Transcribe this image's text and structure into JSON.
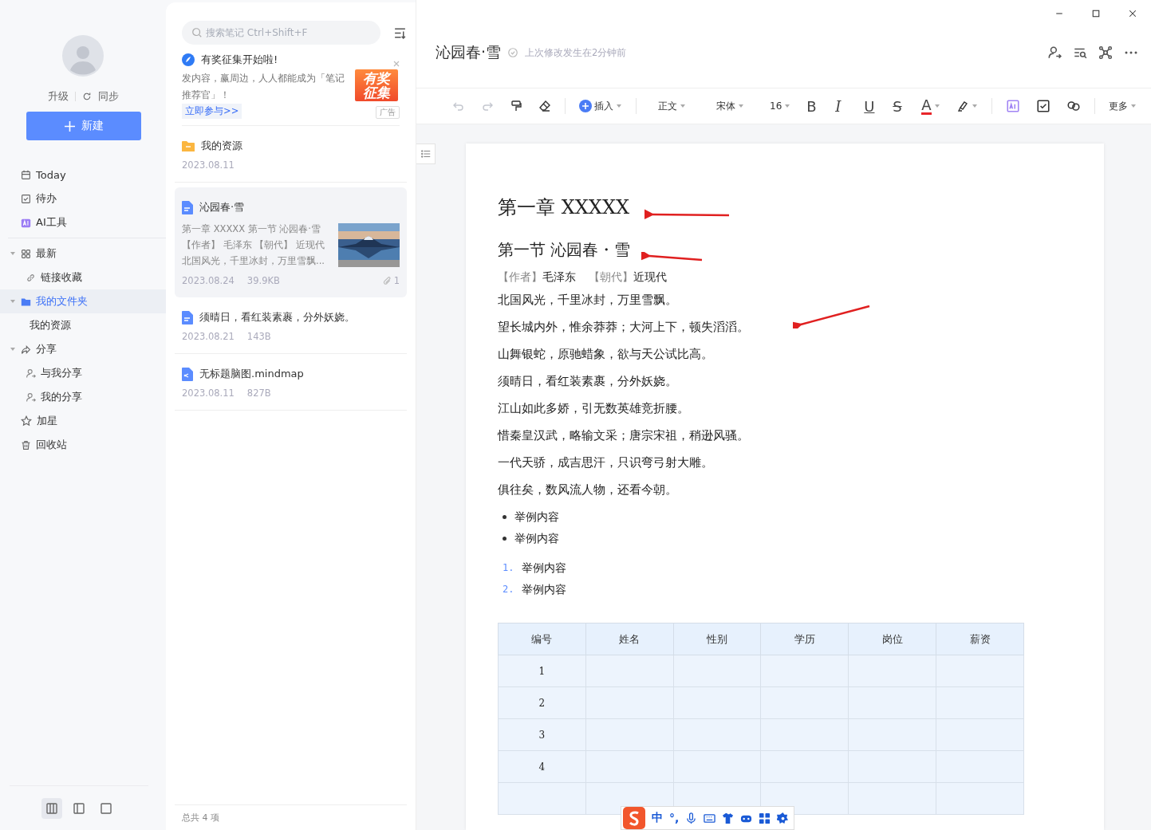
{
  "sidebar": {
    "upgrade": "升级",
    "sync": "同步",
    "new_button": "新建",
    "nav": [
      {
        "label": "Today",
        "selected": false
      },
      {
        "label": "待办",
        "selected": false
      },
      {
        "label": "AI工具",
        "selected": false
      }
    ],
    "tree": [
      {
        "label": "最新",
        "expanded": true,
        "selected": false,
        "children": [
          {
            "label": "链接收藏",
            "selected": false
          }
        ]
      },
      {
        "label": "我的文件夹",
        "expanded": true,
        "selected": true,
        "children": [
          {
            "label": "我的资源",
            "selected": false
          }
        ]
      },
      {
        "label": "分享",
        "expanded": true,
        "selected": false,
        "children": [
          {
            "label": "与我分享",
            "selected": false
          },
          {
            "label": "我的分享",
            "selected": false
          }
        ]
      },
      {
        "label": "加星",
        "selected": false
      },
      {
        "label": "回收站",
        "selected": false
      }
    ],
    "view_modes": [
      {
        "selected": true
      },
      {
        "selected": false
      },
      {
        "selected": false
      }
    ]
  },
  "note_list": {
    "search": {
      "placeholder": "搜索笔记 Ctrl+Shift+F"
    },
    "ad": {
      "title": "有奖征集开始啦!",
      "text": "发内容，赢周边，人人都能成为「笔记推荐官」！",
      "link": "立即参与>>",
      "banner": [
        "有奖",
        "征集"
      ],
      "tag": "广告"
    },
    "notes": [
      {
        "kind": "folder",
        "title": "我的资源",
        "date": "2023.08.11",
        "selected": false
      },
      {
        "kind": "doc",
        "title": "沁园春·雪",
        "preview": [
          "第一章 XXXXX 第一节 沁园春·雪",
          "【作者】 毛泽东 【朝代】 近现代",
          "北国风光，千里冰封，万里雪飘..."
        ],
        "thumbnail": {
          "kind": "picture"
        },
        "date": "2023.08.24",
        "size": "39.9KB",
        "attachments": "1",
        "selected": true
      },
      {
        "kind": "doc",
        "title": "须晴日，看红装素裹，分外妖娆。",
        "date": "2023.08.21",
        "size": "143B",
        "selected": false
      },
      {
        "kind": "mindmap",
        "title": "无标题脑图.mindmap",
        "date": "2023.08.11",
        "size": "827B",
        "selected": false
      }
    ],
    "footer": "总共 4 项"
  },
  "editor": {
    "title": "沁园春·雪",
    "status": "上次修改发生在2分钟前",
    "toolbar": {
      "history": [
        {
          "disabled": true
        },
        {
          "disabled": true
        }
      ],
      "insert": "插入",
      "style": "正文",
      "font": "宋体",
      "size": "16",
      "bold": "B",
      "italic": "I",
      "underline": "U",
      "strike": "S",
      "font_color": "A",
      "more": "更多"
    },
    "document": {
      "heading1": "第一章  XXXXX",
      "heading2": "第一节  沁园春・雪",
      "meta": [
        {
          "label": "【作者】",
          "value": "毛泽东"
        },
        {
          "label": "【朝代】",
          "value": "近现代"
        }
      ],
      "paragraphs": [
        "北国风光，千里冰封，万里雪飘。",
        "望长城内外，惟余莽莽；大河上下，顿失滔滔。",
        "山舞银蛇，原驰蜡象，欲与天公试比高。",
        "须晴日，看红装素裹，分外妖娆。",
        "江山如此多娇，引无数英雄竞折腰。",
        "惜秦皇汉武，略输文采；唐宗宋祖，稍逊风骚。",
        "一代天骄，成吉思汗，只识弯弓射大雕。",
        "俱往矣，数风流人物，还看今朝。"
      ],
      "bullets": [
        "举例内容",
        "举例内容"
      ],
      "numbered": [
        {
          "marker": "1.",
          "text": "举例内容"
        },
        {
          "marker": "2.",
          "text": "举例内容"
        }
      ],
      "table": {
        "columns": [
          "编号",
          "姓名",
          "性别",
          "学历",
          "岗位",
          "薪资"
        ],
        "rows": [
          {
            "number": "1"
          },
          {
            "number": "2"
          },
          {
            "number": "3"
          },
          {
            "number": "4"
          },
          {
            "kind": "blank"
          }
        ]
      },
      "annotations": [
        {
          "kind": "arrow"
        },
        {
          "kind": "arrow"
        },
        {
          "kind": "arrow"
        }
      ]
    }
  },
  "ime_bar": {
    "language": "中",
    "punctuation": "°,"
  }
}
